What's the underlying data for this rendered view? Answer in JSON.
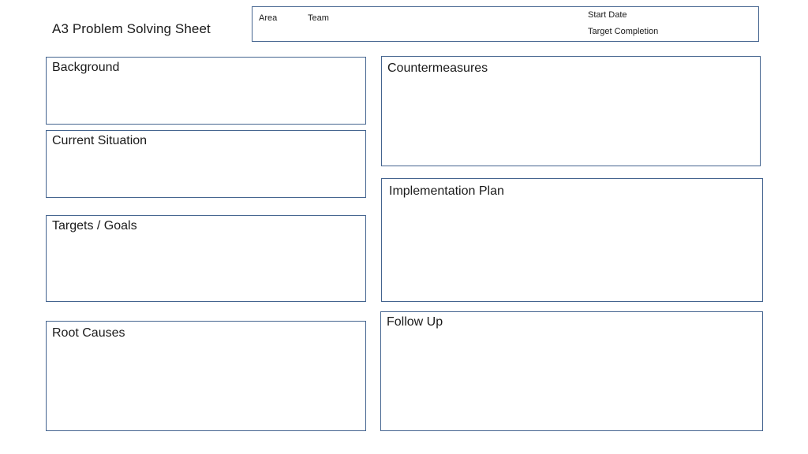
{
  "title": "A3 Problem Solving Sheet",
  "header": {
    "area_label": "Area",
    "team_label": "Team",
    "start_date_label": "Start Date",
    "target_completion_label": "Target Completion"
  },
  "sections": {
    "background": "Background",
    "current_situation": "Current Situation",
    "targets_goals": "Targets / Goals",
    "root_causes": "Root Causes",
    "countermeasures": "Countermeasures",
    "implementation_plan": "Implementation Plan",
    "follow_up": "Follow Up"
  },
  "colors": {
    "border": "#44648f",
    "text": "#1a1a1a",
    "background": "#ffffff"
  }
}
